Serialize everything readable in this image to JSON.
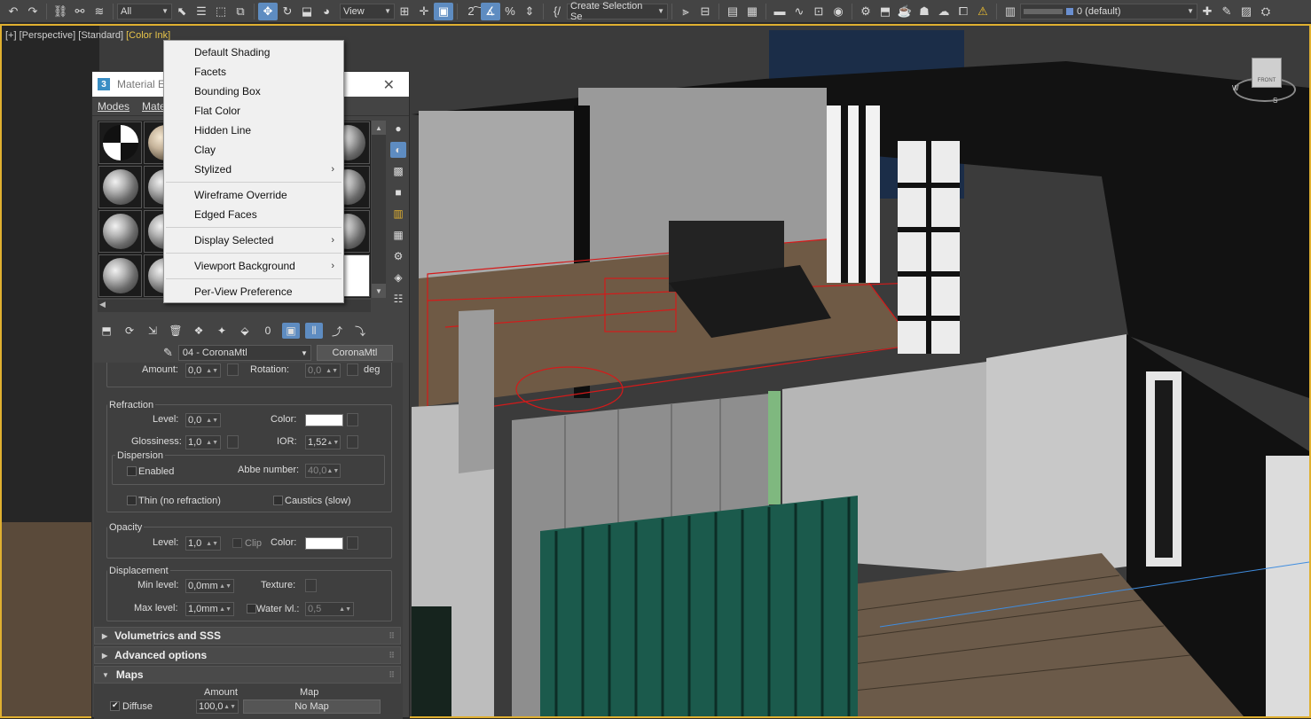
{
  "toolbar": {
    "filter_value": "All",
    "refcoord_value": "View",
    "selection_set_placeholder": "Create Selection Se",
    "layer_value": "0 (default)",
    "icons_left": [
      "undo-icon",
      "redo-icon",
      "link-icon",
      "unlink-icon",
      "bind-spacewarp-icon"
    ],
    "icons_select": [
      "select-object-icon",
      "select-by-name-icon",
      "rect-region-icon",
      "window-crossing-icon",
      "move-icon",
      "rotate-icon",
      "scale-icon",
      "place-icon"
    ],
    "icons_snaps": [
      "pivot-icon",
      "snap-toggle-icon",
      "angle-snap-icon",
      "percent-snap-icon",
      "spinner-snap-icon"
    ],
    "icons_right": [
      "mirror-icon",
      "align-icon",
      "toggle-scene-explorer-icon",
      "toggle-layer-explorer-icon",
      "ribbon-icon",
      "curve-editor-icon",
      "schematic-view-icon",
      "material-editor-icon",
      "render-setup-icon",
      "rendered-frame-icon",
      "render-icon",
      "render-iterative-icon",
      "render-cloud-icon",
      "a360-icon",
      "warning-icon",
      "layer-manager-icon"
    ]
  },
  "viewport": {
    "label_plus": "[+]",
    "label_view": "[Perspective]",
    "label_mode": "[Standard]",
    "label_shading": "[Color Ink]",
    "viewcube_label": "FRONT",
    "viewcube_w": "W",
    "viewcube_s": "S"
  },
  "material_editor": {
    "title": "Material E",
    "close_glyph": "✕",
    "menus": [
      "Modes",
      "Mate"
    ],
    "material_name": "04 - CoronaMtl",
    "material_type": "CoronaMtl",
    "amount_row": {
      "amount_label": "Amount:",
      "amount_value": "0,0",
      "rotation_label": "Rotation:",
      "rotation_value": "0,0",
      "unit": "deg"
    },
    "refraction": {
      "title": "Refraction",
      "level_label": "Level:",
      "level_value": "0,0",
      "color_label": "Color:",
      "glossiness_label": "Glossiness:",
      "glossiness_value": "1,0",
      "ior_label": "IOR:",
      "ior_value": "1,52",
      "dispersion_title": "Dispersion",
      "enabled_label": "Enabled",
      "abbe_label": "Abbe number:",
      "abbe_value": "40,0",
      "thin_label": "Thin (no refraction)",
      "caustics_label": "Caustics (slow)"
    },
    "opacity": {
      "title": "Opacity",
      "level_label": "Level:",
      "level_value": "1,0",
      "clip_label": "Clip",
      "color_label": "Color:"
    },
    "displacement": {
      "title": "Displacement",
      "min_label": "Min level:",
      "min_value": "0,0mm",
      "texture_label": "Texture:",
      "max_label": "Max level:",
      "max_value": "1,0mm",
      "water_label": "Water lvl.:",
      "water_value": "0,5"
    },
    "rollouts": {
      "volumetrics": "Volumetrics and SSS",
      "advanced": "Advanced options",
      "maps": "Maps"
    },
    "maps_table": {
      "amount_header": "Amount",
      "map_header": "Map",
      "rows": [
        {
          "name": "Diffuse",
          "amount": "100,0",
          "map": "No Map"
        }
      ]
    }
  },
  "context_menu": {
    "group1": [
      "Default Shading",
      "Facets",
      "Bounding Box",
      "Flat Color",
      "Hidden Line",
      "Clay",
      "Stylized"
    ],
    "group2": [
      "Wireframe Override",
      "Edged Faces"
    ],
    "group3": [
      "Display Selected"
    ],
    "group4": [
      "Viewport Background"
    ],
    "group5": [
      "Per-View Preference"
    ],
    "submenu_arrow": "›"
  }
}
